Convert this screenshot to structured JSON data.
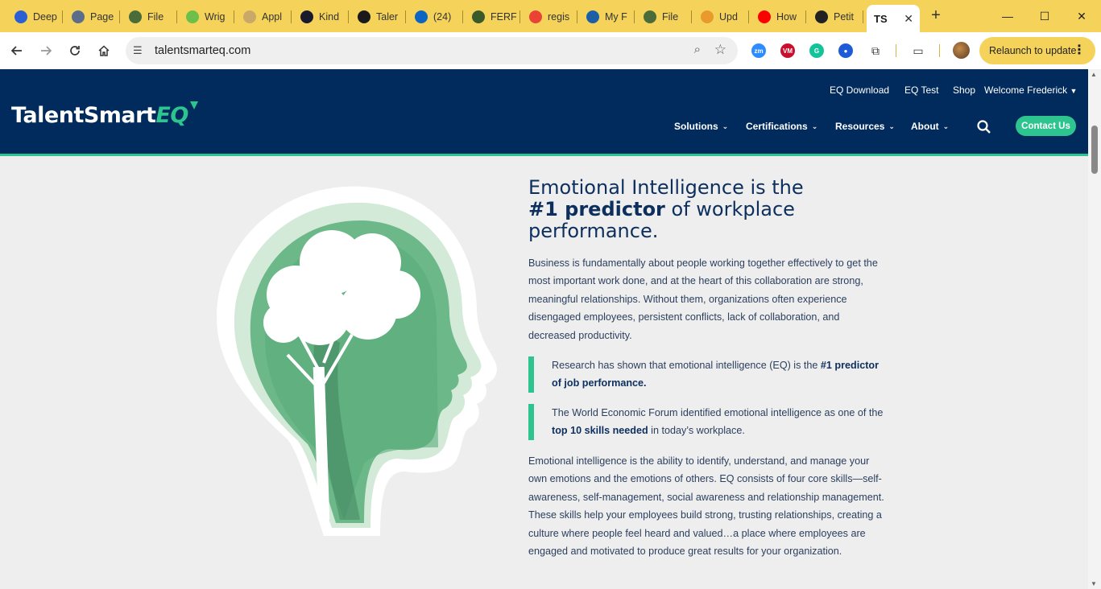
{
  "browser": {
    "tabs": [
      {
        "label": "Deep",
        "icon": "deepl-icon",
        "color": "#2a5fd6"
      },
      {
        "label": "Page",
        "icon": "page-icon",
        "color": "#5b6d8a"
      },
      {
        "label": "File",
        "icon": "file-icon",
        "color": "#4a6b3a"
      },
      {
        "label": "Wrig",
        "icon": "play-icon",
        "color": "#6cc04a"
      },
      {
        "label": "Appl",
        "icon": "apply-icon",
        "color": "#c9a86a"
      },
      {
        "label": "Kind",
        "icon": "kindle-icon",
        "color": "#1a1a2e"
      },
      {
        "label": "Taler",
        "icon": "ts-icon",
        "color": "#1a1a1a"
      },
      {
        "label": "(24)",
        "icon": "linkedin-icon",
        "color": "#0a66c2"
      },
      {
        "label": "FERF",
        "icon": "ferf-icon",
        "color": "#3a5a2a"
      },
      {
        "label": "regis",
        "icon": "google-icon",
        "color": "#ea4335"
      },
      {
        "label": "My F",
        "icon": "dell-icon",
        "color": "#1b5fa8"
      },
      {
        "label": "File",
        "icon": "file-icon",
        "color": "#4a6b3a"
      },
      {
        "label": "Upd",
        "icon": "update-icon",
        "color": "#e89a2c"
      },
      {
        "label": "How",
        "icon": "youtube-icon",
        "color": "#ff0000"
      },
      {
        "label": "Petit",
        "icon": "chatgpt-icon",
        "color": "#222222"
      }
    ],
    "active_tab": {
      "label": "TS",
      "close": "✕"
    },
    "new_tab": "+",
    "window_controls": {
      "minimize": "—",
      "maximize": "☐",
      "close": "✕"
    },
    "url": "talentsmarteq.com",
    "relaunch_label": "Relaunch to update",
    "extensions": [
      {
        "name": "zoom-icon",
        "text": "zm",
        "color": "#2d8cff"
      },
      {
        "name": "vm-icon",
        "text": "VM",
        "color": "#c8102e"
      },
      {
        "name": "grammarly-icon",
        "text": "G",
        "color": "#15c39a"
      },
      {
        "name": "circle-ext-icon",
        "text": "●",
        "color": "#1e5bd6"
      }
    ]
  },
  "site": {
    "logo": {
      "main": "TalentSmart",
      "accent": "EQ"
    },
    "utility_nav": [
      "EQ Download",
      "EQ Test",
      "Shop",
      "Welcome Frederick"
    ],
    "main_nav": [
      "Solutions",
      "Certifications",
      "Resources",
      "About"
    ],
    "contact_label": "Contact Us",
    "colors": {
      "navy": "#002b5c",
      "green": "#2ec48f"
    }
  },
  "hero": {
    "title_line1": "Emotional Intelligence is the",
    "title_bold": "#1 predictor",
    "title_rest": " of workplace performance.",
    "intro": "Business is fundamentally about people working together effectively to get the most important work done, and at the heart of this collaboration are strong, meaningful relationships. Without them, organizations often experience disengaged employees, persistent conflicts, lack of collaboration, and decreased productivity.",
    "quote1_pre": "Research has shown that emotional intelligence (EQ) is the ",
    "quote1_bold": "#1 predictor of job performance.",
    "quote2_pre": "The World Economic Forum identified emotional intelligence as one of the ",
    "quote2_bold": "top 10 skills needed",
    "quote2_post": " in today’s workplace.",
    "closing": "Emotional intelligence is the ability to identify, understand, and manage your own emotions and the emotions of others. EQ consists of four core skills—self-awareness, self-management, social awareness and relationship management. These skills help your employees build strong, trusting relationships, creating a culture where people feel heard and valued…a place where employees are engaged and motivated to produce great results for your organization."
  }
}
